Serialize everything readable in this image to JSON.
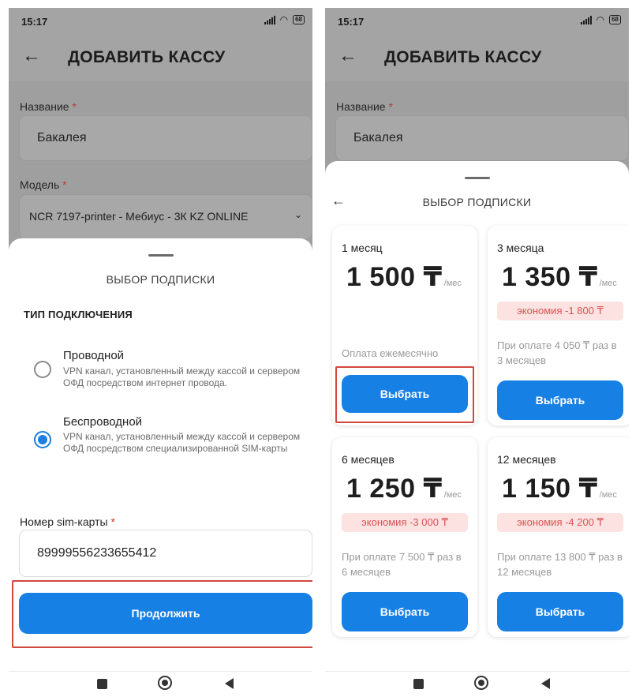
{
  "status": {
    "time": "15:17",
    "battery": "68"
  },
  "appbar": {
    "title": "ДОБАВИТЬ КАССУ"
  },
  "form": {
    "name_label": "Название",
    "name_value": "Бакалея",
    "model_label": "Модель",
    "model_value": "NCR 7197-printer - Мебиус - 3К KZ ONLINE",
    "required_mark": "*"
  },
  "sheet": {
    "title": "ВЫБОР ПОДПИСКИ",
    "section": "ТИП ПОДКЛЮЧЕНИЯ",
    "options": [
      {
        "title": "Проводной",
        "desc": "VPN канал, установленный между кассой и сервером ОФД посредством интернет провода.",
        "selected": false
      },
      {
        "title": "Беспроводной",
        "desc": "VPN канал, установленный между кассой и сервером ОФД посредством специализированной SIM-карты",
        "selected": true
      }
    ],
    "sim_label": "Номер sim-карты",
    "sim_value": "89999556233655412",
    "continue_label": "Продолжить"
  },
  "plans": [
    {
      "name": "1 месяц",
      "price": "1 500 ₸",
      "per": "/мес",
      "saving": "",
      "note": "Оплата ежемесячно",
      "button": "Выбрать",
      "highlighted": true
    },
    {
      "name": "3 месяца",
      "price": "1 350 ₸",
      "per": "/мес",
      "saving": "экономия -1 800 ₸",
      "note": "При оплате 4 050 ₸ раз в 3 месяцев",
      "button": "Выбрать",
      "highlighted": false
    },
    {
      "name": "6 месяцев",
      "price": "1 250 ₸",
      "per": "/мес",
      "saving": "экономия -3 000 ₸",
      "note": "При оплате 7 500 ₸ раз в 6 месяцев",
      "button": "Выбрать",
      "highlighted": false
    },
    {
      "name": "12 месяцев",
      "price": "1 150 ₸",
      "per": "/мес",
      "saving": "экономия -4 200 ₸",
      "note": "При оплате 13 800 ₸ раз в 12 месяцев",
      "button": "Выбрать",
      "highlighted": false
    }
  ],
  "icons": {
    "back": "arrow-left-icon",
    "chevron": "chevron-down-icon",
    "nav": [
      "recents-square-icon",
      "home-circle-icon",
      "back-triangle-icon"
    ]
  },
  "colors": {
    "accent": "#1780e5",
    "highlight": "#d2473f",
    "saving_bg": "#fde2e2",
    "saving_text": "#d75454"
  }
}
